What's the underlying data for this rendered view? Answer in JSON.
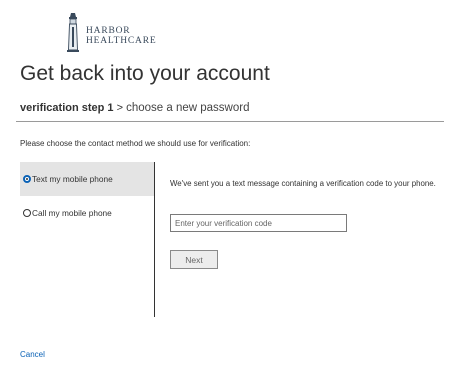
{
  "brand": {
    "line1": "HARBOR",
    "line2": "HEALTHCARE"
  },
  "page": {
    "title": "Get back into your account"
  },
  "steps": {
    "current": "verification step 1",
    "separator": ">",
    "next": "choose a new password"
  },
  "instructions": "Please choose the contact method we should use for verification:",
  "methods": [
    {
      "label": "Text my mobile phone",
      "selected": true
    },
    {
      "label": "Call my mobile phone",
      "selected": false
    }
  ],
  "verification": {
    "message": "We've sent you a text message containing a verification code to your phone.",
    "code_placeholder": "Enter your verification code",
    "code_value": "",
    "next_label": "Next"
  },
  "cancel_label": "Cancel",
  "colors": {
    "link": "#0a62b6",
    "selected_bg": "#e4e4e4",
    "text": "#333333"
  }
}
